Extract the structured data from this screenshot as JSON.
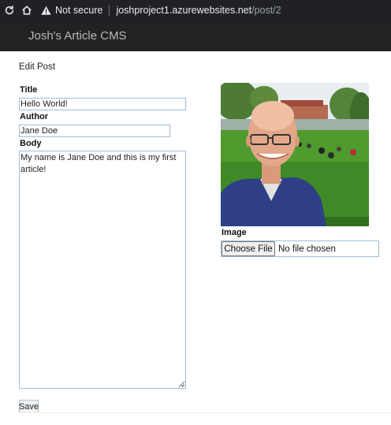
{
  "browser": {
    "security_label": "Not secure",
    "url_host": "joshproject1.azurewebsites.net",
    "url_path": "/post/2"
  },
  "app": {
    "brand": "Josh's Article CMS"
  },
  "page": {
    "heading": "Edit Post"
  },
  "form": {
    "title_label": "Title",
    "title_value": "Hello World!",
    "author_label": "Author",
    "author_value": "Jane Doe",
    "body_label": "Body",
    "body_value": "My name is Jane Doe and this is my first article!",
    "image_label": "Image",
    "choose_file_label": "Choose File",
    "file_status": "No file chosen",
    "save_label": "Save"
  },
  "icons": {
    "reload": "reload-icon",
    "home": "home-icon",
    "warning": "warning-icon"
  }
}
